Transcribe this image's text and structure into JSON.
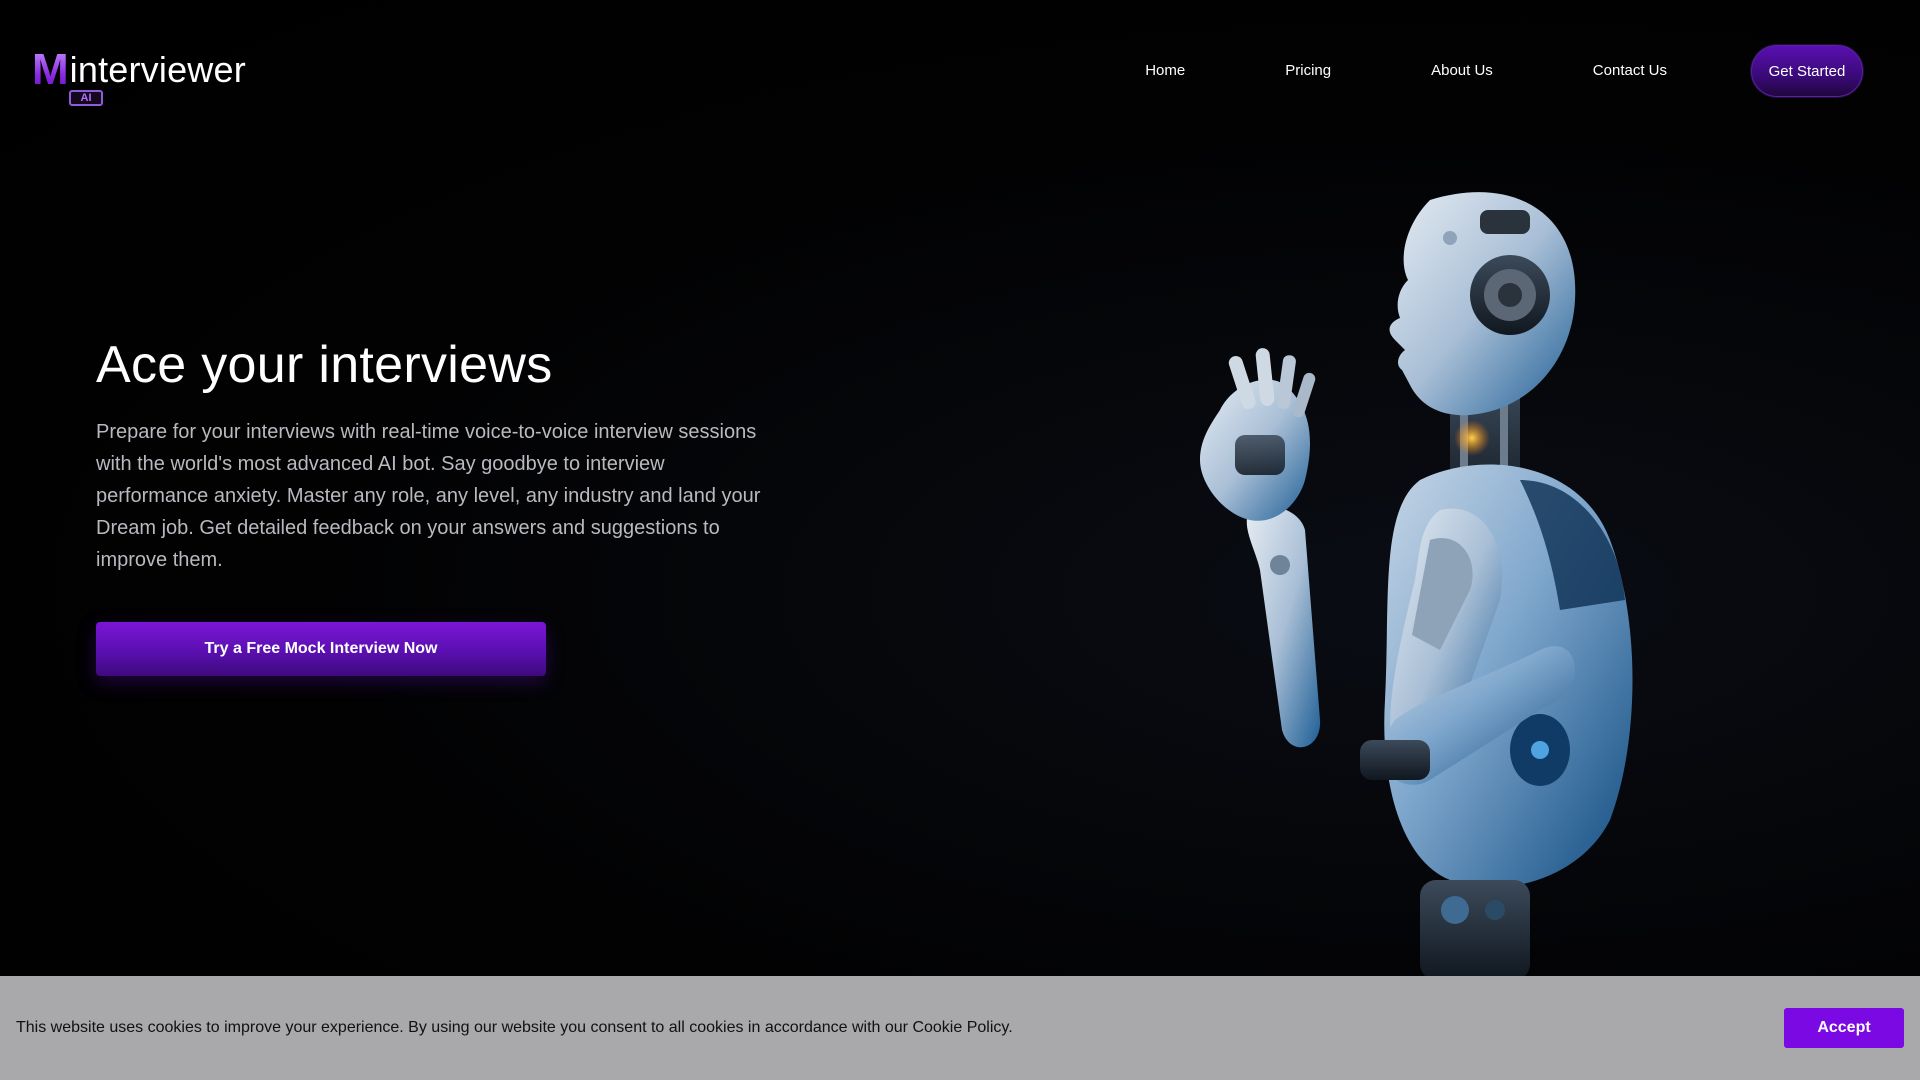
{
  "brand": {
    "logo_letter": "M",
    "logo_text": "interviewer",
    "logo_badge": "AI",
    "accent_color": "#7a09e3"
  },
  "nav": {
    "items": [
      {
        "label": "Home"
      },
      {
        "label": "Pricing"
      },
      {
        "label": "About Us"
      },
      {
        "label": "Contact Us"
      }
    ],
    "cta_label": "Get Started"
  },
  "hero": {
    "title": "Ace your interviews",
    "description": "Prepare for your interviews with real-time voice-to-voice interview sessions with the world's most advanced AI bot. Say goodbye to interview performance anxiety. Master any role, any level, any industry and land your Dream job. Get detailed feedback on your answers and suggestions to improve them.",
    "cta_label": "Try a Free Mock Interview Now",
    "image_icon": "robot-illustration"
  },
  "cookie_banner": {
    "text": "This website uses cookies to improve your experience. By using our website you consent to all cookies in accordance with our Cookie Policy.",
    "accept_label": "Accept",
    "background_color": "#a9a8aa"
  }
}
